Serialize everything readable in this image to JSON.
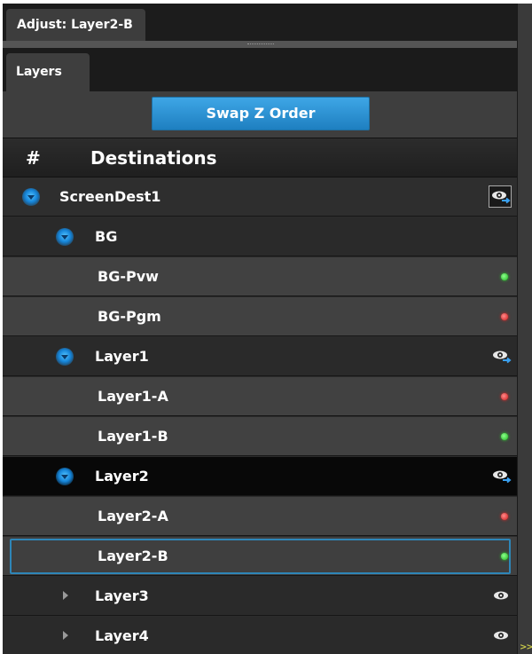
{
  "window": {
    "adjust_tab": "Adjust: Layer2-B"
  },
  "tabs": {
    "layers": "Layers"
  },
  "toolbar": {
    "swap_label": "Swap Z Order"
  },
  "table_header": {
    "number": "#",
    "destinations": "Destinations"
  },
  "tree": [
    {
      "label": "ScreenDest1",
      "level": 0,
      "expander": "expanded",
      "indicator": "eye-boxed"
    },
    {
      "label": "BG",
      "level": 1,
      "expander": "expanded",
      "indicator": "none"
    },
    {
      "label": "BG-Pvw",
      "level": 2,
      "expander": "none",
      "indicator": "green-dot"
    },
    {
      "label": "BG-Pgm",
      "level": 2,
      "expander": "none",
      "indicator": "red-dot"
    },
    {
      "label": "Layer1",
      "level": 1,
      "expander": "expanded",
      "indicator": "eye-arrow"
    },
    {
      "label": "Layer1-A",
      "level": 2,
      "expander": "none",
      "indicator": "red-dot"
    },
    {
      "label": "Layer1-B",
      "level": 2,
      "expander": "none",
      "indicator": "green-dot"
    },
    {
      "label": "Layer2",
      "level": 1,
      "expander": "expanded",
      "indicator": "eye-arrow",
      "highlight": "parent"
    },
    {
      "label": "Layer2-A",
      "level": 2,
      "expander": "none",
      "indicator": "red-dot"
    },
    {
      "label": "Layer2-B",
      "level": 2,
      "expander": "none",
      "indicator": "green-dot",
      "highlight": "selected"
    },
    {
      "label": "Layer3",
      "level": 1,
      "expander": "collapsed",
      "indicator": "eye"
    },
    {
      "label": "Layer4",
      "level": 1,
      "expander": "collapsed",
      "indicator": "eye"
    }
  ],
  "colors": {
    "accent_blue": "#1e7fc0",
    "selection_border": "#2e86b8",
    "live_green": "#1eb81e",
    "live_red": "#d01818"
  },
  "side_strip": {
    "glyph": ">>"
  }
}
